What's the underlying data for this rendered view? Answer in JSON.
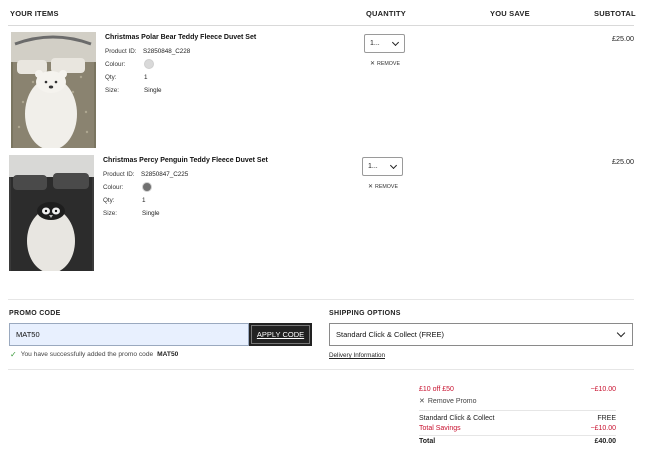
{
  "header": {
    "your_items": "YOUR ITEMS",
    "quantity": "QUANTITY",
    "you_save": "YOU SAVE",
    "subtotal": "SUBTOTAL"
  },
  "items": [
    {
      "name": "Christmas Polar Bear Teddy Fleece Duvet Set",
      "product_id_label": "Product ID:",
      "product_id": "S2850848_C228",
      "colour_label": "Colour:",
      "colour_hex": "#d9d9d9",
      "qty_label": "Qty:",
      "qty": "1",
      "size_label": "Size:",
      "size": "Single",
      "qty_select": "1...",
      "remove_label": "REMOVE",
      "price": "£25.00"
    },
    {
      "name": "Christmas Percy Penguin Teddy Fleece Duvet Set",
      "product_id_label": "Product ID:",
      "product_id": "S2850847_C225",
      "colour_label": "Colour:",
      "colour_hex": "#707070",
      "qty_label": "Qty:",
      "qty": "1",
      "size_label": "Size:",
      "size": "Single",
      "qty_select": "1...",
      "remove_label": "REMOVE",
      "price": "£25.00"
    }
  ],
  "promo": {
    "title": "PROMO CODE",
    "code_value": "MAT50",
    "apply_label": "APPLY CODE",
    "success_prefix": "You have successfully added the promo code",
    "success_code": "MAT50"
  },
  "shipping": {
    "title": "SHIPPING OPTIONS",
    "selected": "Standard Click & Collect (FREE)",
    "delivery_info": "Delivery Information"
  },
  "totals": {
    "promo_line_label": "£10 off £50",
    "promo_line_value": "−£10.00",
    "remove_promo": "Remove Promo",
    "shipping_label": "Standard Click & Collect",
    "shipping_value": "FREE",
    "savings_label": "Total Savings",
    "savings_value": "−£10.00",
    "total_label": "Total",
    "total_value": "£40.00"
  },
  "colors": {
    "accent_red": "#c8102e",
    "button_dark": "#222222",
    "input_fill": "#e8f0fe"
  },
  "icons": [
    "close-icon",
    "check-icon",
    "chevron-down-icon"
  ]
}
